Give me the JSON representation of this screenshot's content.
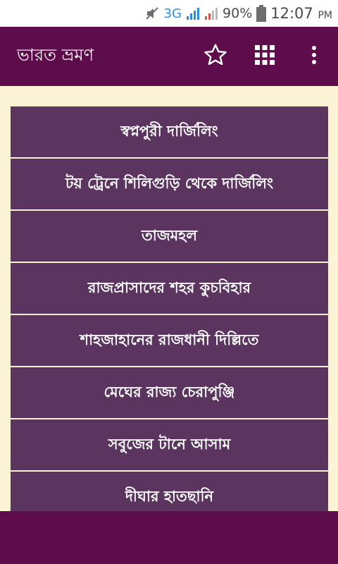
{
  "status_bar": {
    "network": "3G",
    "battery": "90%",
    "time": "12:07",
    "ampm": "PM"
  },
  "app_bar": {
    "title": "ভারত ভ্রমণ",
    "icons": [
      "star-icon",
      "grid-icon",
      "more-vert-icon"
    ]
  },
  "list": {
    "items": [
      {
        "label": "স্বপ্নপুরী দার্জিলিং"
      },
      {
        "label": "টয় ট্রেনে শিলিগুড়ি থেকে দার্জিলিং"
      },
      {
        "label": "তাজমহল"
      },
      {
        "label": "রাজপ্রাসাদের শহর কুচবিহার"
      },
      {
        "label": "শাহজাহানের রাজধানী দিল্লিতে"
      },
      {
        "label": "মেঘের রাজ্য চেরাপুঞ্জি"
      },
      {
        "label": "সবুজের টানে আসাম"
      },
      {
        "label": "দীঘার হাতছানি"
      }
    ]
  },
  "colors": {
    "app_bar": "#5e0c4c",
    "list_item": "#5b3560",
    "background": "#fcf2d6"
  }
}
